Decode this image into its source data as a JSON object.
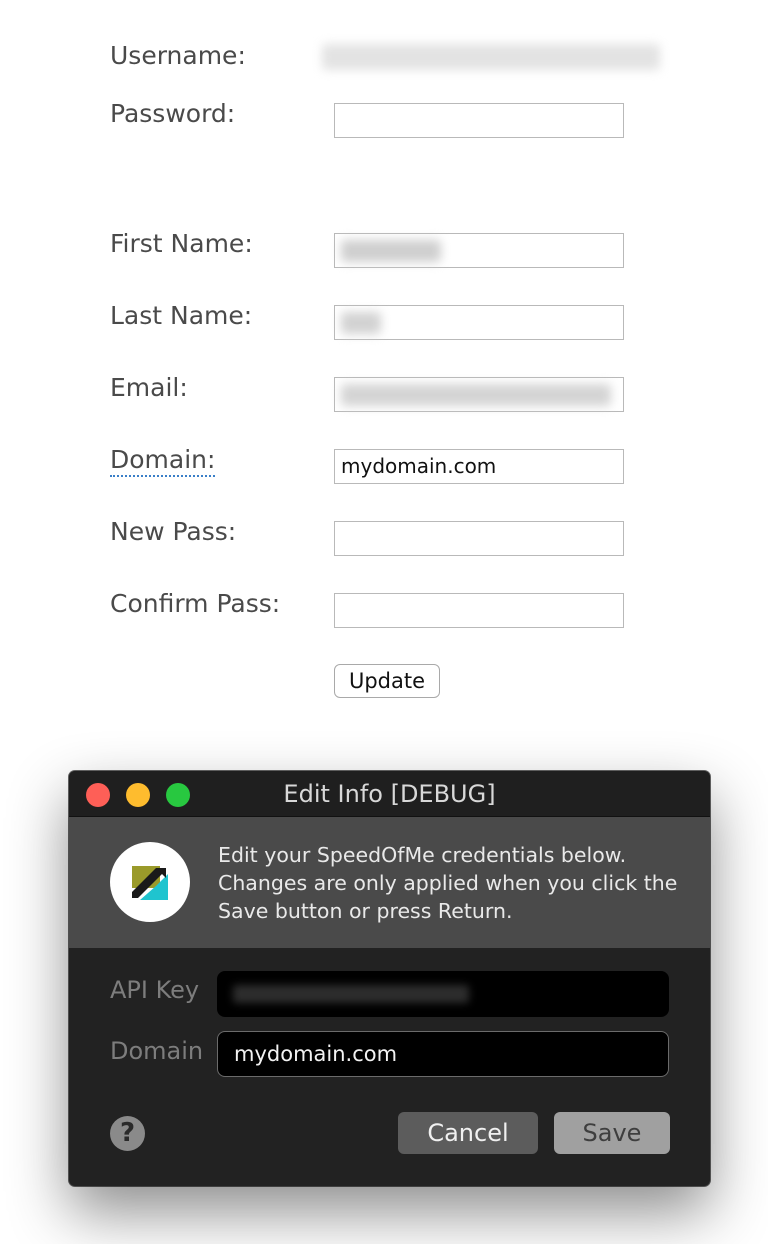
{
  "form": {
    "username_label": "Username:",
    "password_label": "Password:",
    "first_name_label": "First Name:",
    "last_name_label": "Last Name:",
    "email_label": "Email:",
    "domain_label": "Domain:",
    "domain_value": "mydomain.com",
    "new_pass_label": "New Pass:",
    "confirm_pass_label": "Confirm Pass:",
    "update_button": "Update"
  },
  "dialog": {
    "title": "Edit Info [DEBUG]",
    "description": "Edit your SpeedOfMe credentials below. Changes are only applied when you click the Save button or press Return.",
    "api_key_label": "API Key",
    "domain_label": "Domain",
    "domain_value": "mydomain.com",
    "help_glyph": "?",
    "cancel_button": "Cancel",
    "save_button": "Save",
    "traffic_lights": {
      "close": "#fe5f57",
      "minimize": "#febc2e",
      "zoom": "#28c840"
    },
    "logo_colors": {
      "olive": "#9a9a2a",
      "teal": "#1fc4cf",
      "dark": "#1a1a1a"
    }
  }
}
